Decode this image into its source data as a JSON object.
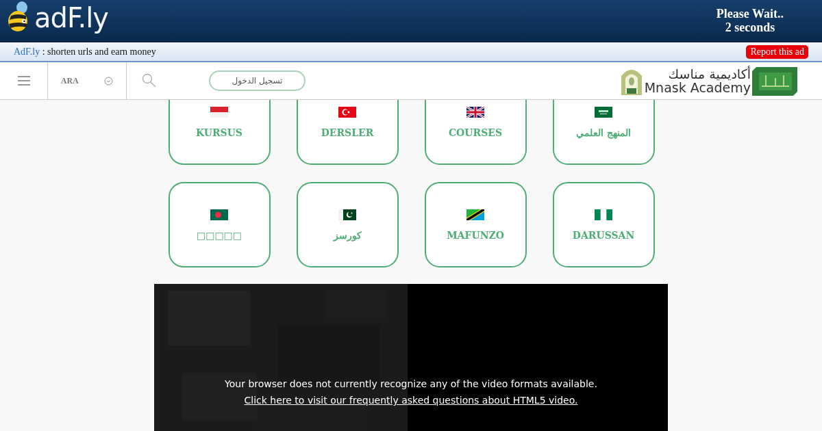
{
  "ad_header": {
    "logo": "adF.ly",
    "wait_title": "Please Wait..",
    "wait_time": "2 seconds"
  },
  "ad_bar": {
    "site_link": "AdF.ly",
    "tagline": " : shorten urls and earn money",
    "report_button": "Report this ad"
  },
  "nav": {
    "language": "ARA",
    "login_button": "تسجيل الدخول",
    "logo_arabic": "أكاديمية مناسك",
    "logo_latin": "Mnask Academy"
  },
  "courses": [
    {
      "label": "KURSUS",
      "kind": "indonesia"
    },
    {
      "label": "DERSLER",
      "kind": "turkey"
    },
    {
      "label": "COURSES",
      "kind": "uk"
    },
    {
      "label": "المنهج العلمي",
      "kind": "saudi"
    },
    {
      "label": "□□□□□",
      "kind": "bangladesh"
    },
    {
      "label": "كورسز",
      "kind": "pakistan"
    },
    {
      "label": "MAFUNZO",
      "kind": "tanzania"
    },
    {
      "label": "DARUSSAN",
      "kind": "nigeria"
    }
  ],
  "video": {
    "message": "Your browser does not currently recognize any of the video formats available.",
    "help_link": "Click here to visit our frequently asked questions about HTML5 video."
  }
}
